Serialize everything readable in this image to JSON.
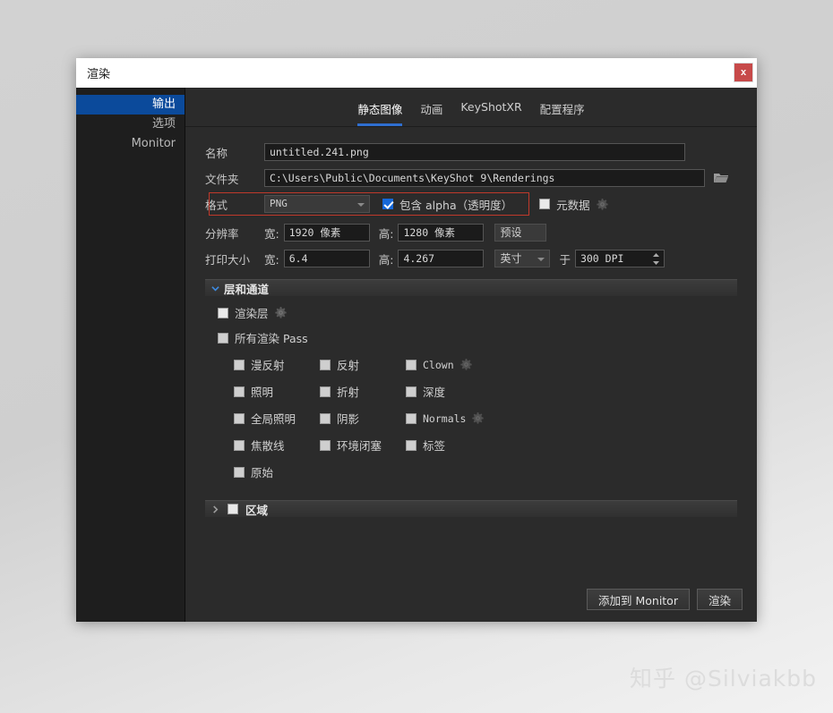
{
  "window": {
    "title": "渲染",
    "close_label": "x"
  },
  "sidebar": {
    "items": [
      {
        "label": "输出",
        "selected": true
      },
      {
        "label": "选项",
        "selected": false
      },
      {
        "label": "Monitor",
        "selected": false
      }
    ]
  },
  "tabs": [
    {
      "label": "静态图像",
      "active": true
    },
    {
      "label": "动画",
      "active": false
    },
    {
      "label": "KeyShotXR",
      "active": false
    },
    {
      "label": "配置程序",
      "active": false
    }
  ],
  "form": {
    "name_label": "名称",
    "name_value": "untitled.241.png",
    "folder_label": "文件夹",
    "folder_value": "C:\\Users\\Public\\Documents\\KeyShot 9\\Renderings",
    "folder_icon": "folder-open-icon",
    "format_label": "格式",
    "format_value": "PNG",
    "alpha_label": "包含 alpha（透明度）",
    "alpha_checked": true,
    "metadata_label": "元数据",
    "metadata_checked": false,
    "metadata_gear": "gear-icon",
    "resolution_label": "分辨率",
    "print_size_label": "打印大小",
    "width_label": "宽:",
    "height_label": "高:",
    "res_width": "1920 像素",
    "res_height": "1280 像素",
    "preset_label": "预设",
    "print_width": "6.4",
    "print_height": "4.267",
    "unit_value": "英寸",
    "at_label": "于",
    "dpi_value": "300 DPI"
  },
  "layers": {
    "section_label": "层和通道",
    "expanded": true,
    "render_layers_label": "渲染层",
    "render_layers_checked": false,
    "render_layers_gear": "gear-icon",
    "all_passes_label": "所有渲染 Pass",
    "all_passes_checked": false,
    "passes": [
      {
        "label": "漫反射",
        "checked": false,
        "gear": false,
        "mono": false
      },
      {
        "label": "反射",
        "checked": false,
        "gear": false,
        "mono": false
      },
      {
        "label": "Clown",
        "checked": false,
        "gear": true,
        "mono": true
      },
      {
        "label": "照明",
        "checked": false,
        "gear": false,
        "mono": false
      },
      {
        "label": "折射",
        "checked": false,
        "gear": false,
        "mono": false
      },
      {
        "label": "深度",
        "checked": false,
        "gear": false,
        "mono": false
      },
      {
        "label": "全局照明",
        "checked": false,
        "gear": false,
        "mono": false
      },
      {
        "label": "阴影",
        "checked": false,
        "gear": false,
        "mono": false
      },
      {
        "label": "Normals",
        "checked": false,
        "gear": true,
        "mono": true
      },
      {
        "label": "焦散线",
        "checked": false,
        "gear": false,
        "mono": false
      },
      {
        "label": "环境闭塞",
        "checked": false,
        "gear": false,
        "mono": false
      },
      {
        "label": "标签",
        "checked": false,
        "gear": false,
        "mono": false
      },
      {
        "label": "原始",
        "checked": false,
        "gear": false,
        "mono": false
      }
    ]
  },
  "region": {
    "section_label": "区域",
    "expanded": false,
    "checked": false
  },
  "footer": {
    "add_to_monitor_label": "添加到 Monitor",
    "render_label": "渲染"
  },
  "watermark": {
    "text": "知乎 @Silviakbb"
  },
  "colors": {
    "accent_blue": "#0b4a9b",
    "tab_underline": "#2f6fd0",
    "checkbox_on": "#1668d8",
    "annotation_red": "#c0392b",
    "close_red": "#c74a4a"
  }
}
